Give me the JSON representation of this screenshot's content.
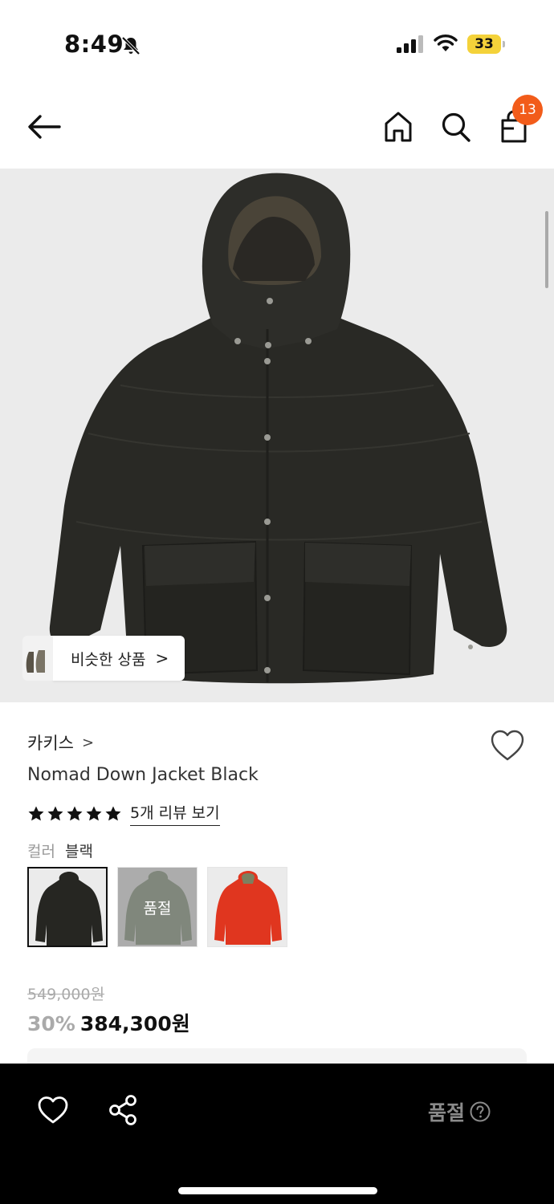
{
  "status_bar": {
    "time": "8:49",
    "battery": "33",
    "icons": [
      "bell-slash-icon",
      "signal-icon",
      "wifi-icon",
      "battery-icon"
    ]
  },
  "nav": {
    "icons": [
      "back-arrow-icon",
      "home-icon",
      "search-icon",
      "cart-icon"
    ],
    "cart_badge": "13",
    "badge_color": "#f25c1a"
  },
  "hero": {
    "similar_label": "비슷한 상품",
    "similar_chevron": ">"
  },
  "product": {
    "brand": "카키스",
    "brand_chevron": ">",
    "title": "Nomad Down Jacket Black",
    "rating_stars": 5,
    "review_link": "5개 리뷰 보기",
    "color_label": "컬러",
    "color_value": "블랙",
    "swatches": [
      {
        "color": "#262622",
        "selected": true
      },
      {
        "color": "#8a9a80",
        "selected": false,
        "overlay": "품절"
      },
      {
        "color": "#e0361f",
        "selected": false
      }
    ],
    "original_price": "549,000원",
    "discount": "30%",
    "final_price": "384,300원"
  },
  "bottom_bar": {
    "icons": [
      "heart-icon",
      "share-icon",
      "help-circle-icon"
    ],
    "soldout_label": "품절"
  }
}
